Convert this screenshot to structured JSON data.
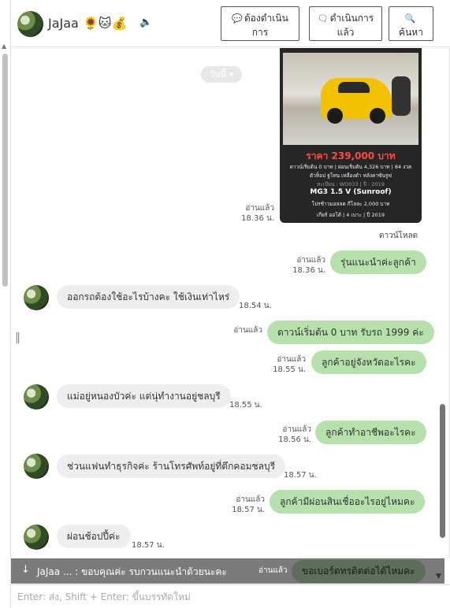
{
  "contact": {
    "name": "JaJaa 🌻🐱💰",
    "avatar": "avatar-photo"
  },
  "header_buttons": {
    "todo": {
      "icon": "chat-bubble-icon",
      "label_line1": "ต้องดำเนิน",
      "label_line2": "การ"
    },
    "done": {
      "icon": "check-chat-icon",
      "label_line1": "ดำเนินการ",
      "label_line2": "แล้ว"
    },
    "search": {
      "icon": "search-icon",
      "label": "ค้นหา"
    }
  },
  "date_chip": "วันนี้",
  "card": {
    "price": "ราคา 239,000 บาท",
    "line1": "ดาวน์เริ่มต้น 0 บาท | ผ่อนเริ่มต้น 4,326 บาท | 84 งวด",
    "line2": "ตัวท็อป ฐโทน เหลืองดำ หลังคาซันรูฟ",
    "line3": "ทะเบียน : WD033 | ปี : 2019",
    "model": "MG3 1.5 V (Sunroof)",
    "line4": "โปรช้าวมอลลด กีโลละ 2,000 บาท",
    "line5": "เกียร์ ออโต้ | 4 เบาะ | ปี 2019",
    "read": "อ่านแล้ว",
    "time": "18.36 น.",
    "download": "ดาวน์โหลด"
  },
  "messages": [
    {
      "dir": "out",
      "text": "รุ่นแนะนำค่ะลูกค้า",
      "read": "อ่านแล้ว",
      "time": "18.36 น."
    },
    {
      "dir": "in",
      "text": "ออกรถต้องใช้อะไรบ้างคะ ใช้เงินเท่าไหร่",
      "time": "18.54 น."
    },
    {
      "dir": "out",
      "text": "ดาวน์เริ่มต้น 0 บาท รับรถ 1999 ค่ะ",
      "read": "อ่านแล้ว",
      "time": ""
    },
    {
      "dir": "out",
      "text": "ลูกค้าอยู่จังหวัดอะไรคะ",
      "read": "อ่านแล้ว",
      "time": "18.55 น."
    },
    {
      "dir": "in",
      "text": "แม่อยู่หนองบัวค่ะ แต่นุ่ทำงานอยู่ชลบุรี",
      "time": "18.55 น."
    },
    {
      "dir": "out",
      "text": "ลูกค้าทำอาชีพอะไรคะ",
      "read": "อ่านแล้ว",
      "time": "18.56 น."
    },
    {
      "dir": "in",
      "text": "ช่วนแฟนทำธุรกิจค่ะ ร้านโทรศัพท์อยู่ที่ตึกคอมชลบุรี",
      "time": "18.57 น."
    },
    {
      "dir": "out",
      "text": "ลูกค้ามีผ่อนสินเชื่ออะไรอยู่ไหมคะ",
      "read": "อ่านแล้ว",
      "time": "18.57 น."
    },
    {
      "dir": "in",
      "text": "ผ่อนช้อปปี้ค่ะ",
      "time": "18.57 น."
    }
  ],
  "banner": {
    "text": "JaJaa ... : ขอบคุณค่ะ รบกวนแนะนำด้วยนะคะ",
    "read": "อ่านแล้ว",
    "bubble": "ขอเบอร์ตทรติดต่อได้ไหมคะ"
  },
  "composer": {
    "placeholder": "Enter: ส่ง, Shift + Enter: ขึ้นบรรทัดใหม่"
  }
}
